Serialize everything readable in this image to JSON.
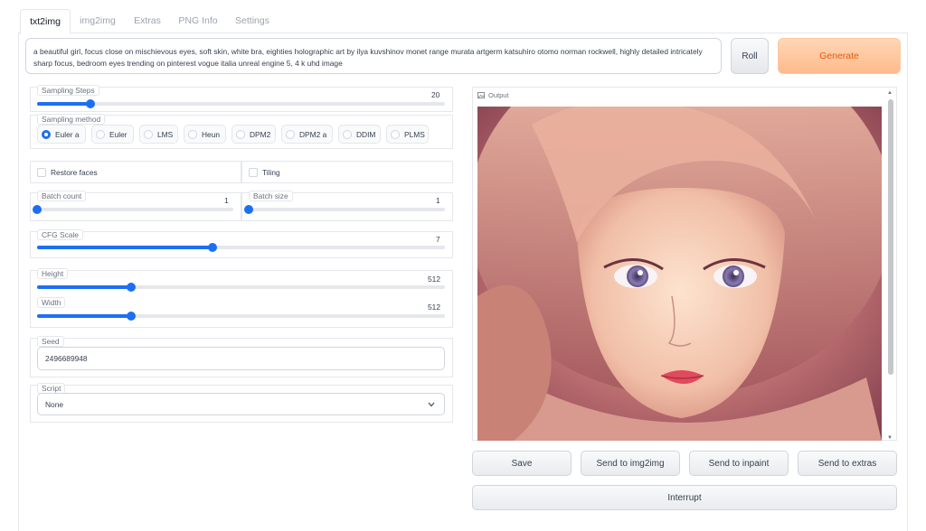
{
  "tabs": [
    "txt2img",
    "img2img",
    "Extras",
    "PNG Info",
    "Settings"
  ],
  "prompt": "a beautiful girl, focus close on mischievous eyes, soft skin, white bra, eighties holographic art by ilya kuvshinov monet range murata artgerm katsuhiro otomo norman rockwell, highly detailed intricately sharp focus, bedroom eyes trending on pinterest vogue italia unreal engine 5, 4 k uhd image",
  "buttons": {
    "roll": "Roll",
    "generate": "Generate",
    "save": "Save",
    "send_img2img": "Send to img2img",
    "send_inpaint": "Send to inpaint",
    "send_extras": "Send to extras",
    "interrupt": "Interrupt"
  },
  "sampling_steps": {
    "label": "Sampling Steps",
    "value": "20",
    "fraction": 0.13
  },
  "sampling_method": {
    "label": "Sampling method",
    "options": [
      "Euler a",
      "Euler",
      "LMS",
      "Heun",
      "DPM2",
      "DPM2 a",
      "DDIM",
      "PLMS"
    ],
    "selected": "Euler a"
  },
  "restore_faces": {
    "label": "Restore faces",
    "checked": false
  },
  "tiling": {
    "label": "Tiling",
    "checked": false
  },
  "batch_count": {
    "label": "Batch count",
    "value": "1",
    "fraction": 0.0
  },
  "batch_size": {
    "label": "Batch size",
    "value": "1",
    "fraction": 0.0
  },
  "cfg_scale": {
    "label": "CFG Scale",
    "value": "7",
    "fraction": 0.43
  },
  "height": {
    "label": "Height",
    "value": "512",
    "fraction": 0.23
  },
  "width": {
    "label": "Width",
    "value": "512",
    "fraction": 0.23
  },
  "seed": {
    "label": "Seed",
    "value": "2496689948"
  },
  "script": {
    "label": "Script",
    "value": "None"
  },
  "output": {
    "label": "Output"
  },
  "colors": {
    "accent": "#1d6ff2",
    "generate_bg": "#fdba8c",
    "generate_text": "#ea580c"
  }
}
